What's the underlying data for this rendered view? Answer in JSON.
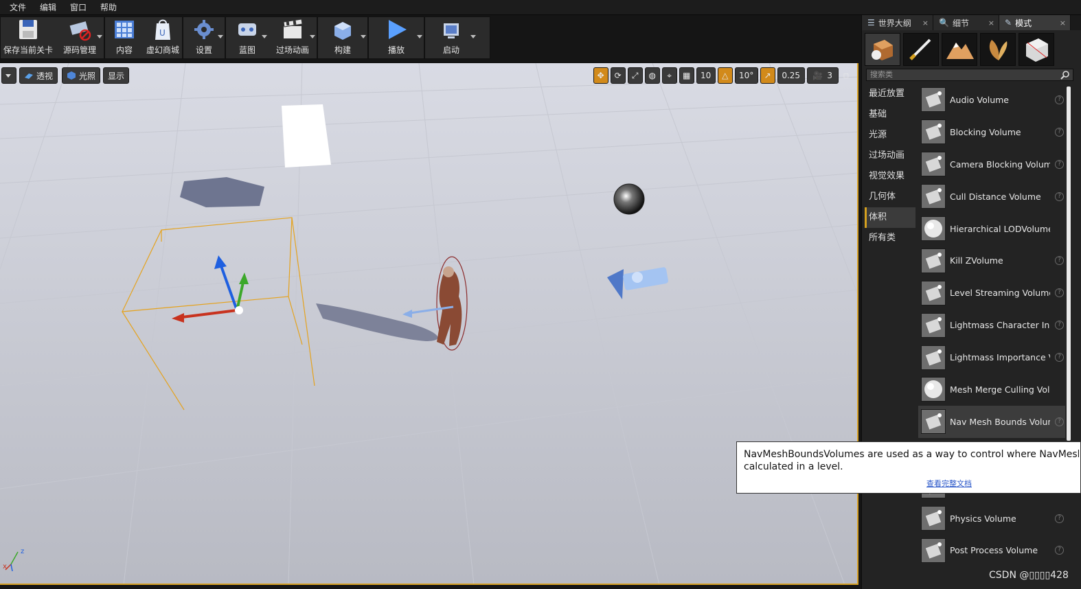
{
  "menu": [
    "文件",
    "编辑",
    "窗口",
    "帮助"
  ],
  "toolbar": [
    {
      "label": "保存当前关卡",
      "icon": "save-icon",
      "w": 80,
      "arrow": false
    },
    {
      "label": "源码管理",
      "icon": "source-control-icon",
      "w": 70,
      "arrow": true
    },
    {
      "label": "内容",
      "icon": "content-icon",
      "w": 56,
      "arrow": false
    },
    {
      "label": "虚幻商城",
      "icon": "marketplace-icon",
      "w": 56,
      "arrow": false
    },
    {
      "label": "设置",
      "icon": "settings-icon",
      "w": 60,
      "arrow": true
    },
    {
      "label": "蓝图",
      "icon": "blueprint-icon",
      "w": 62,
      "arrow": true
    },
    {
      "label": "过场动画",
      "icon": "cinematics-icon",
      "w": 70,
      "arrow": true
    },
    {
      "label": "构建",
      "icon": "build-icon",
      "w": 72,
      "arrow": true
    },
    {
      "label": "播放",
      "icon": "play-icon",
      "w": 80,
      "arrow": true
    },
    {
      "label": "启动",
      "icon": "launch-icon",
      "w": 76,
      "arrow": true
    }
  ],
  "viewport": {
    "perspective": "透视",
    "lit": "光照",
    "show": "显示",
    "grid_snap": "10",
    "rotate_snap": "10°",
    "scale_snap": "0.25",
    "camera_speed": "3"
  },
  "panel": {
    "tabs": [
      {
        "label": "世界大纲视图",
        "display": "世界大纲",
        "icon": "outliner-icon",
        "active": false
      },
      {
        "label": "细节",
        "display": "细节",
        "icon": "details-icon",
        "active": false
      },
      {
        "label": "模式",
        "display": "模式",
        "icon": "modes-icon",
        "active": true
      }
    ],
    "mode_icons": [
      "place-mode-icon",
      "paint-mode-icon",
      "landscape-mode-icon",
      "foliage-mode-icon",
      "geometry-mode-icon"
    ],
    "search_placeholder": "搜索类",
    "categories": [
      "最近放置",
      "基础",
      "光源",
      "过场动画",
      "视觉效果",
      "几何体",
      "体积",
      "所有类"
    ],
    "active_category": 6,
    "items": [
      "Audio Volume",
      "Blocking Volume",
      "Camera Blocking Volume",
      "Cull Distance Volume",
      "Hierarchical LODVolume",
      "Kill ZVolume",
      "Level Streaming Volume",
      "Lightmass Character Ind",
      "Lightmass Importance Vo",
      "Mesh Merge Culling Volume",
      "Nav Mesh Bounds Volum",
      "",
      "",
      "Physics Volume",
      "Post Process Volume"
    ],
    "items_without_help": [
      4,
      9
    ]
  },
  "tooltip": {
    "text": "NavMeshBoundsVolumes are used as a way to control where NavMesh is calculated in a level.",
    "line1": "NavMeshBoundsVolumes are used as a way to control where NavMesh",
    "line2": "calculated in a level.",
    "link": "查看完整文档"
  },
  "watermark": "CSDN @\u0000\u0000\u0000\u0000428"
}
